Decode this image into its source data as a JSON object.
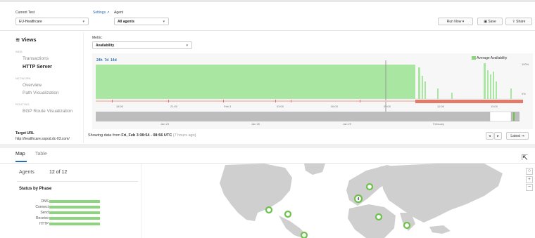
{
  "header": {
    "current_test_label": "Current Test",
    "current_test_value": "EU-Healthcare",
    "settings_label": "Settings",
    "agent_label": "Agent",
    "agent_value": "All agents",
    "run_now_label": "Run Now",
    "save_label": "Save",
    "share_label": "Share"
  },
  "sidebar": {
    "views_title": "Views",
    "sections": [
      {
        "heading": "WEB",
        "items": [
          "Transactions",
          "HTTP Server"
        ]
      },
      {
        "heading": "NETWORK",
        "items": [
          "Overview",
          "Path Visualization"
        ]
      },
      {
        "heading": "ROUTING",
        "items": [
          "BGP Route Visualization"
        ]
      }
    ],
    "active_item": "HTTP Server",
    "target_url_label": "Target URL",
    "target_url_value": "http://healthcare.sxpod.dc-03.com/"
  },
  "metric": {
    "label": "Metric",
    "value": "Availability"
  },
  "timeline": {
    "ranges": [
      "24h",
      "7d",
      "14d"
    ],
    "legend": "Average Availability",
    "y_top": "100%",
    "y_bottom": "0%",
    "x_ticks": [
      "18:00",
      "21:00",
      "Feb 3",
      "03:00",
      "06:00",
      "09:00",
      "12:00",
      "15:00"
    ],
    "overview_ticks": [
      "Jan 23",
      "Jan 26",
      "Jan 29",
      "February"
    ],
    "showing_prefix": "Showing data from",
    "showing_range": "Fri, Feb 3 08:54 - 08:56 UTC",
    "showing_ago": "(7 hours ago)",
    "latest_label": "Latest",
    "prev_label": "◂",
    "next_label": "▸"
  },
  "tabs": [
    "Map",
    "Table"
  ],
  "active_tab": "Map",
  "summary": {
    "agents_label": "Agents",
    "agents_value": "12 of 12",
    "status_title": "Status by Phase",
    "phases": [
      "DNS",
      "Connect",
      "Send",
      "Receive",
      "HTTP"
    ]
  },
  "map": {
    "agent_badge": "4",
    "zoom_in": "+",
    "zoom_out": "−",
    "zoom_reset": "○"
  },
  "colors": {
    "availability": "#a8e6a1",
    "accent": "#2b6cb0",
    "agent": "#6cc24a",
    "error_band": "#e07a6a"
  }
}
